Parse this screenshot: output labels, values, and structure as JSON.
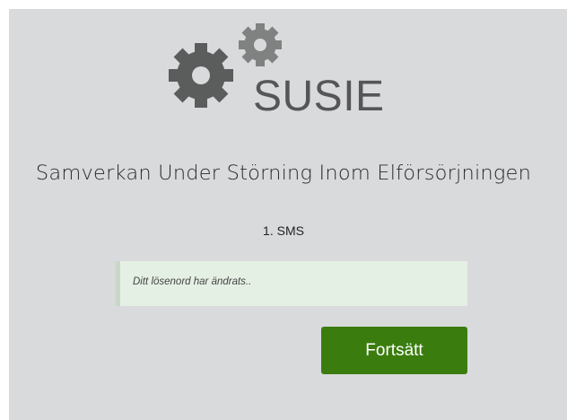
{
  "app": {
    "logo_text": "SUSIE",
    "logo_icon": "gears-icon",
    "subtitle": "Samverkan Under Störning Inom Elförsörjningen"
  },
  "step": {
    "label": "1. SMS"
  },
  "message": {
    "text": "Ditt lösenord har ändrats.."
  },
  "actions": {
    "continue_label": "Fortsätt"
  },
  "colors": {
    "background": "#d9dadc",
    "gear": "#5b5c5c",
    "button": "#3a7d0e",
    "message_bg": "#e5f0e4"
  }
}
